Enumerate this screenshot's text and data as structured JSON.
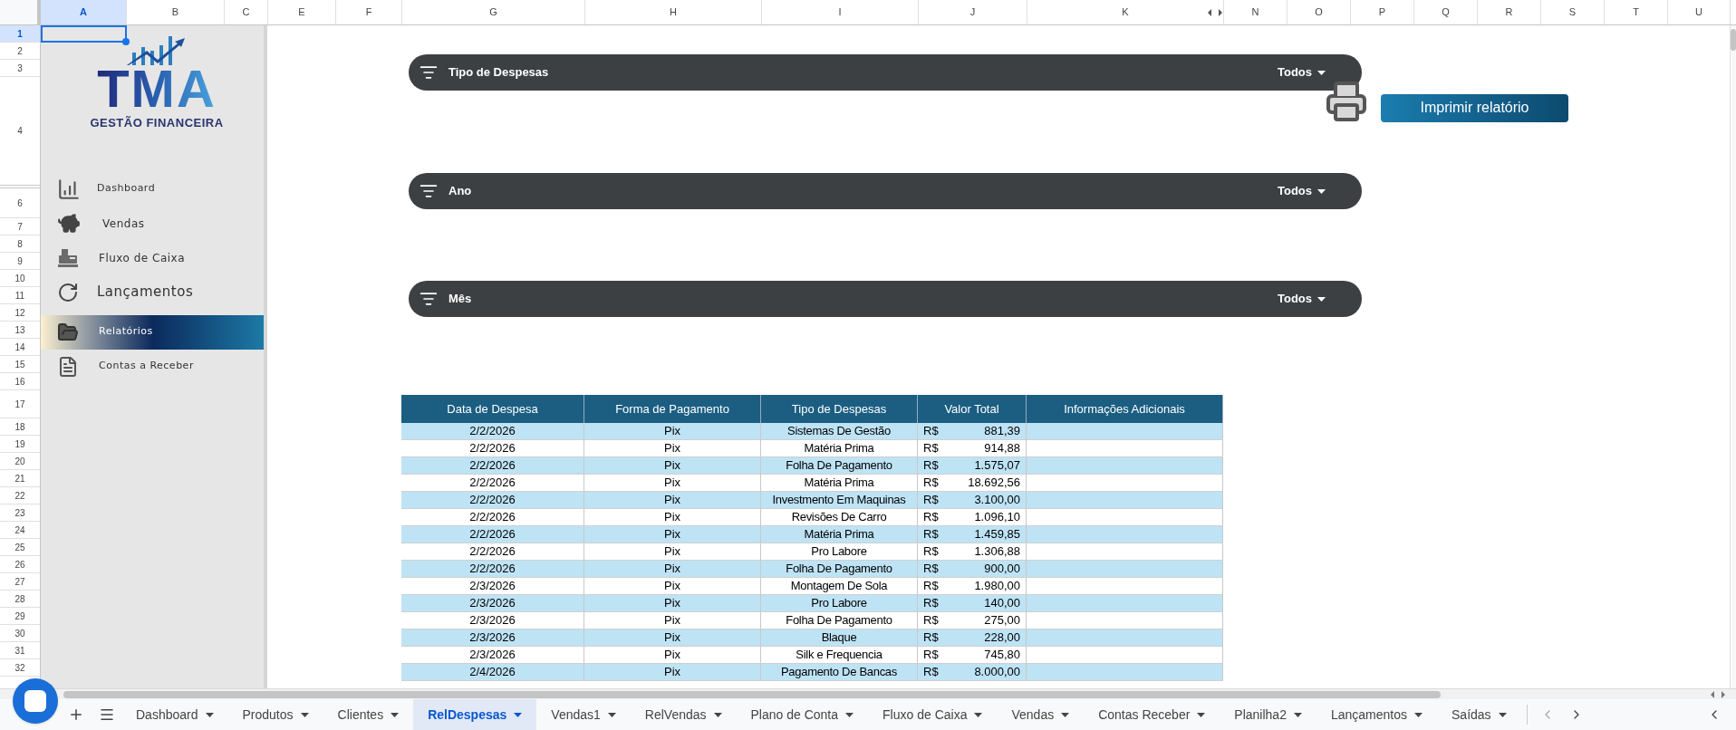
{
  "columns": [
    {
      "label": "A",
      "selected": true
    },
    {
      "label": "B",
      "selected": false
    },
    {
      "label": "C",
      "selected": false
    },
    {
      "label": "E",
      "selected": false
    },
    {
      "label": "F",
      "selected": false
    },
    {
      "label": "G",
      "selected": false
    },
    {
      "label": "H",
      "selected": false
    },
    {
      "label": "I",
      "selected": false
    },
    {
      "label": "J",
      "selected": false
    },
    {
      "label": "K",
      "selected": false
    },
    {
      "label": "N",
      "selected": false
    },
    {
      "label": "O",
      "selected": false
    },
    {
      "label": "P",
      "selected": false
    },
    {
      "label": "Q",
      "selected": false
    },
    {
      "label": "R",
      "selected": false
    },
    {
      "label": "S",
      "selected": false
    },
    {
      "label": "T",
      "selected": false
    },
    {
      "label": "U",
      "selected": false
    }
  ],
  "rows": [
    {
      "label": "1",
      "selected": true
    },
    {
      "label": "2",
      "selected": false
    },
    {
      "label": "3",
      "selected": false
    },
    {
      "label": "4",
      "selected": false
    },
    {
      "label": "6",
      "selected": false
    },
    {
      "label": "7",
      "selected": false
    },
    {
      "label": "8",
      "selected": false
    },
    {
      "label": "9",
      "selected": false
    },
    {
      "label": "10",
      "selected": false
    },
    {
      "label": "11",
      "selected": false
    },
    {
      "label": "12",
      "selected": false
    },
    {
      "label": "13",
      "selected": false
    },
    {
      "label": "14",
      "selected": false
    },
    {
      "label": "15",
      "selected": false
    },
    {
      "label": "16",
      "selected": false
    },
    {
      "label": "17",
      "selected": false
    },
    {
      "label": "18",
      "selected": false
    },
    {
      "label": "19",
      "selected": false
    },
    {
      "label": "20",
      "selected": false
    },
    {
      "label": "21",
      "selected": false
    },
    {
      "label": "22",
      "selected": false
    },
    {
      "label": "23",
      "selected": false
    },
    {
      "label": "24",
      "selected": false
    },
    {
      "label": "25",
      "selected": false
    },
    {
      "label": "26",
      "selected": false
    },
    {
      "label": "27",
      "selected": false
    },
    {
      "label": "28",
      "selected": false
    },
    {
      "label": "29",
      "selected": false
    },
    {
      "label": "30",
      "selected": false
    },
    {
      "label": "31",
      "selected": false
    },
    {
      "label": "32",
      "selected": false
    }
  ],
  "sidebar": {
    "logo": {
      "title": "TMA",
      "subtitle": "GESTÃO FINANCEIRA"
    },
    "items": [
      {
        "label": "Dashboard",
        "selected": false
      },
      {
        "label": "Vendas",
        "selected": false
      },
      {
        "label": "Fluxo de Caixa",
        "selected": false
      },
      {
        "label": "Lançamentos",
        "selected": false
      },
      {
        "label": "Relatórios",
        "selected": true
      },
      {
        "label": "Contas a Receber",
        "selected": false
      }
    ]
  },
  "filters": [
    {
      "label": "Tipo de Despesas",
      "value": "Todos"
    },
    {
      "label": "Ano",
      "value": "Todos"
    },
    {
      "label": "Mês",
      "value": "Todos"
    }
  ],
  "print_button": {
    "label": "Imprimir relatório"
  },
  "table": {
    "columns": [
      "Data de Despesa",
      "Forma de Pagamento",
      "Tipo de Despesas",
      "Valor Total",
      "Informações Adicionais"
    ],
    "rows": [
      {
        "date": "2/2/2026",
        "payment": "Pix",
        "type": "Sistemas De Gestão",
        "currency": "R$",
        "amount": "881,39"
      },
      {
        "date": "2/2/2026",
        "payment": "Pix",
        "type": "Matéria Prima",
        "currency": "R$",
        "amount": "914,88"
      },
      {
        "date": "2/2/2026",
        "payment": "Pix",
        "type": "Folha De Pagamento",
        "currency": "R$",
        "amount": "1.575,07"
      },
      {
        "date": "2/2/2026",
        "payment": "Pix",
        "type": "Matéria Prima",
        "currency": "R$",
        "amount": "18.692,56"
      },
      {
        "date": "2/2/2026",
        "payment": "Pix",
        "type": "Investmento Em Maquinas",
        "currency": "R$",
        "amount": "3.100,00"
      },
      {
        "date": "2/2/2026",
        "payment": "Pix",
        "type": "Revisões De Carro",
        "currency": "R$",
        "amount": "1.096,10"
      },
      {
        "date": "2/2/2026",
        "payment": "Pix",
        "type": "Matéria Prima",
        "currency": "R$",
        "amount": "1.459,85"
      },
      {
        "date": "2/2/2026",
        "payment": "Pix",
        "type": "Pro Labore",
        "currency": "R$",
        "amount": "1.306,88"
      },
      {
        "date": "2/2/2026",
        "payment": "Pix",
        "type": "Folha De Pagamento",
        "currency": "R$",
        "amount": "900,00"
      },
      {
        "date": "2/3/2026",
        "payment": "Pix",
        "type": "Montagem De Sola",
        "currency": "R$",
        "amount": "1.980,00"
      },
      {
        "date": "2/3/2026",
        "payment": "Pix",
        "type": "Pro Labore",
        "currency": "R$",
        "amount": "140,00"
      },
      {
        "date": "2/3/2026",
        "payment": "Pix",
        "type": "Folha De Pagamento",
        "currency": "R$",
        "amount": "275,00"
      },
      {
        "date": "2/3/2026",
        "payment": "Pix",
        "type": "Blaque",
        "currency": "R$",
        "amount": "228,00"
      },
      {
        "date": "2/3/2026",
        "payment": "Pix",
        "type": "Silk e Frequencia",
        "currency": "R$",
        "amount": "745,80"
      },
      {
        "date": "2/4/2026",
        "payment": "Pix",
        "type": "Pagamento De Bancas",
        "currency": "R$",
        "amount": "8.000,00"
      }
    ]
  },
  "sheet_tabs": [
    {
      "label": "Dashboard",
      "selected": false
    },
    {
      "label": "Produtos",
      "selected": false
    },
    {
      "label": "Clientes",
      "selected": false
    },
    {
      "label": "RelDespesas",
      "selected": true
    },
    {
      "label": "Vendas1",
      "selected": false
    },
    {
      "label": "RelVendas",
      "selected": false
    },
    {
      "label": "Plano de Conta",
      "selected": false
    },
    {
      "label": "Fluxo de Caixa",
      "selected": false
    },
    {
      "label": "Vendas",
      "selected": false
    },
    {
      "label": "Contas Receber",
      "selected": false
    },
    {
      "label": "Planilha2",
      "selected": false
    },
    {
      "label": "Lançamentos",
      "selected": false
    },
    {
      "label": "Saídas",
      "selected": false
    }
  ]
}
